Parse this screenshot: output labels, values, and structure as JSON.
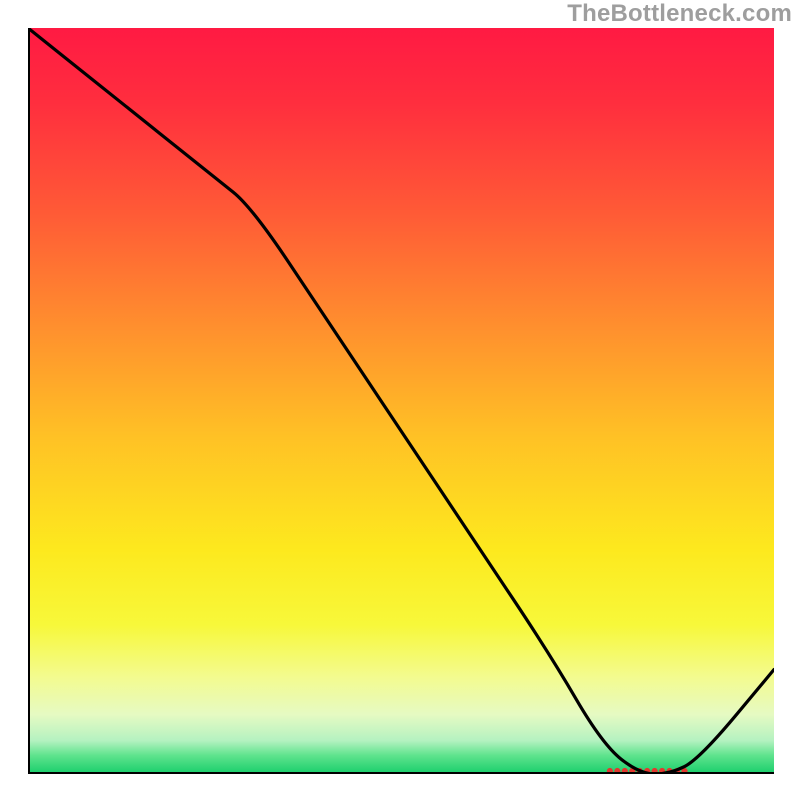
{
  "watermark": "TheBottleneck.com",
  "chart_data": {
    "type": "line",
    "title": "",
    "xlabel": "",
    "ylabel": "",
    "xlim": [
      0,
      100
    ],
    "ylim": [
      0,
      100
    ],
    "series": [
      {
        "name": "curve",
        "x": [
          0,
          10,
          25,
          30,
          40,
          50,
          60,
          70,
          77,
          82,
          86,
          90,
          100
        ],
        "y": [
          100,
          92,
          80,
          76,
          61,
          46,
          31,
          16,
          4,
          0,
          0,
          2,
          14
        ]
      }
    ],
    "marker_band": {
      "x_start": 78,
      "x_end": 88,
      "y": 0.4
    },
    "gradient_stops": [
      {
        "offset": 0.0,
        "color": "#FF1A43"
      },
      {
        "offset": 0.1,
        "color": "#FF2E3E"
      },
      {
        "offset": 0.25,
        "color": "#FF5B36"
      },
      {
        "offset": 0.4,
        "color": "#FF8F2E"
      },
      {
        "offset": 0.55,
        "color": "#FFC225"
      },
      {
        "offset": 0.7,
        "color": "#FDE91E"
      },
      {
        "offset": 0.8,
        "color": "#F7F83A"
      },
      {
        "offset": 0.87,
        "color": "#F3FB8F"
      },
      {
        "offset": 0.92,
        "color": "#E6FAC2"
      },
      {
        "offset": 0.955,
        "color": "#B5F2C1"
      },
      {
        "offset": 0.975,
        "color": "#5FE38D"
      },
      {
        "offset": 1.0,
        "color": "#18CE6B"
      }
    ],
    "axis_color": "#000000",
    "axis_width": 4
  }
}
